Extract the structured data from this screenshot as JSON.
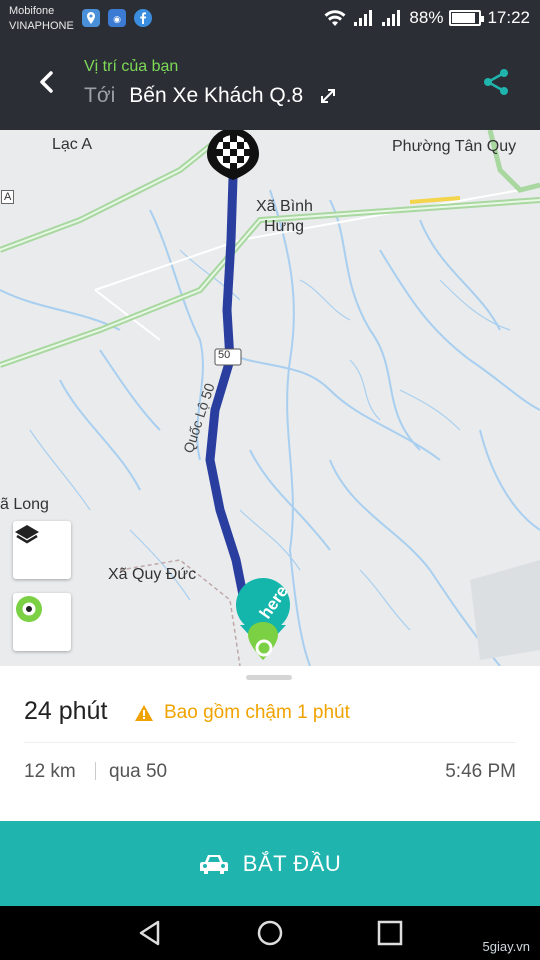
{
  "status_bar": {
    "carrier_1": "Mobifone",
    "carrier_2": "VINAPHONE",
    "battery_percent": "88%",
    "battery_level": 0.88,
    "time": "17:22"
  },
  "header": {
    "origin_label": "Vị trí của bạn",
    "dest_prefix": "Tới",
    "dest_name": "Bến Xe Khách Q.8"
  },
  "map": {
    "places": {
      "lac_a": "Lạc A",
      "phuong_tan_quy": "Phường Tân Quy",
      "xa_binh": "Xã Bình",
      "hung": "Hưng",
      "xa_quy_duc": "Xã Quy Đức",
      "long": "ã Long",
      "road_badge": "50",
      "road_name": "Quốc Lộ 50",
      "side_a": "A"
    },
    "route_color": "#2a3ea0"
  },
  "trip": {
    "duration": "24 phút",
    "delay_note": "Bao gồm chậm 1 phút",
    "distance": "12 km",
    "via": "qua 50",
    "arrival": "5:46 PM"
  },
  "start_button": {
    "label": "BẮT ĐẦU"
  },
  "watermark": "5giay.vn",
  "colors": {
    "accent": "#1fb4ad",
    "origin_green": "#7ed957",
    "warning": "#f0a300"
  }
}
